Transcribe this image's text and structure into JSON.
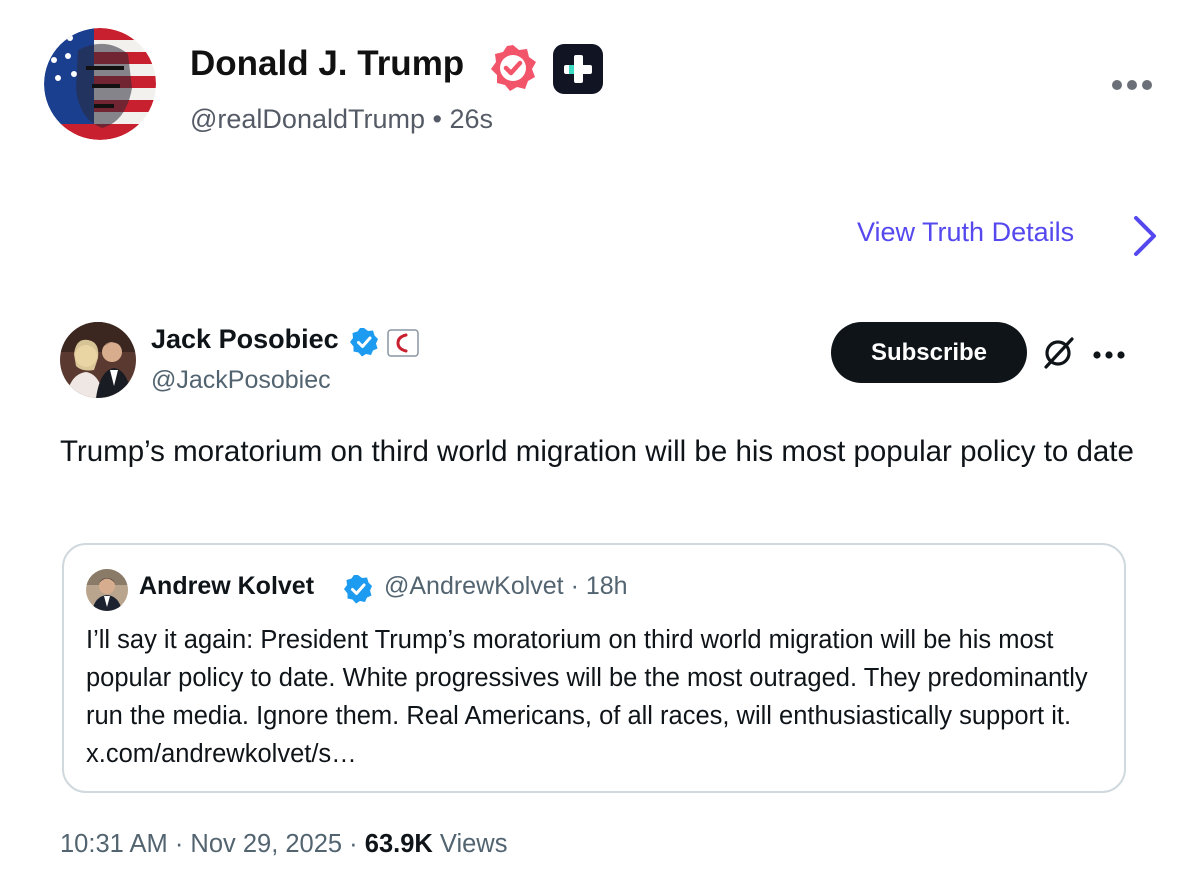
{
  "truth_post": {
    "author_name": "Donald J. Trump",
    "author_handle": "@realDonaldTrump",
    "separator": "•",
    "time_ago": "26s",
    "view_details_label": "View Truth Details",
    "icons": [
      "avatar-flag-portrait",
      "verified-badge-icon",
      "plus-app-icon",
      "more-options-icon",
      "chevron-right-icon"
    ],
    "colors": {
      "link": "#5448EE",
      "verified_badge": "#F2546A",
      "plus_icon_bg": "#101423"
    }
  },
  "x_post": {
    "author_name": "Jack Posobiec",
    "author_handle": "@JackPosobiec",
    "subscribe_label": "Subscribe",
    "text": "Trump’s moratorium on third world migration will be his most popular policy to date",
    "timestamp": "10:31 AM · Nov 29, 2025 · ",
    "views_count": "63.9K",
    "views_label": " Views",
    "icons": [
      "verified-check-icon",
      "affiliate-badge-icon",
      "grok-icon",
      "more-options-icon"
    ],
    "colors": {
      "verified": "#1D9BF0",
      "subscribe_bg": "#0F1419"
    }
  },
  "quoted_post": {
    "author_name": "Andrew Kolvet",
    "author_handle": "@AndrewKolvet",
    "time": " · 18h",
    "text": "I’ll say it again: President Trump’s moratorium on third world migration will be his most popular policy to date. White progressives will be the most outraged. They predominantly run the media. Ignore them. Real Americans, of all races, will enthusiastically support it. x.com/andrewkolvet/s…"
  }
}
